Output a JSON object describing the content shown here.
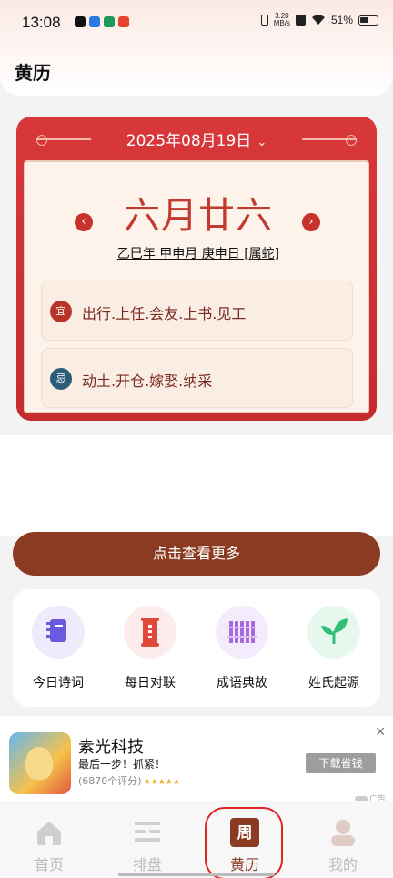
{
  "status_bar": {
    "time": "13:08",
    "net_speed_value": "3.20",
    "net_speed_unit": "MB/s",
    "battery": "51%"
  },
  "header": {
    "title": "黄历"
  },
  "calendar": {
    "date": "2025年08月19日",
    "lunar_date": "六月廿六",
    "ganzhi": "乙巳年 甲申月 庚申日 [属蛇]",
    "yi_badge": "宜",
    "yi_text": "出行.上任.会友.上书.见工",
    "ji_badge": "忌",
    "ji_text": "动土.开仓.嫁娶.纳采"
  },
  "more_button": "点击查看更多",
  "quick_links": [
    {
      "label": "今日诗词",
      "icon": "book-icon",
      "color": "#6a5ae0"
    },
    {
      "label": "每日对联",
      "icon": "scroll-icon",
      "color": "#e0483a"
    },
    {
      "label": "成语典故",
      "icon": "bamboo-slips-icon",
      "color": "#a86ae0"
    },
    {
      "label": "姓氏起源",
      "icon": "sprout-icon",
      "color": "#2ebf74"
    }
  ],
  "ad": {
    "name": "素光科技",
    "subtitle": "最后一步！抓紧！",
    "rating": "(6870个评分)",
    "stars": "★★★★★",
    "button": "下载省钱",
    "close": "✕",
    "tag": "广告"
  },
  "bottom_nav": [
    {
      "label": "首页",
      "icon": "home-icon",
      "active": false
    },
    {
      "label": "排盘",
      "icon": "chart-icon",
      "active": false
    },
    {
      "label": "黄历",
      "icon": "calendar-icon",
      "glyph": "周",
      "active": true
    },
    {
      "label": "我的",
      "icon": "profile-icon",
      "active": false
    }
  ],
  "colors": {
    "brand_red": "#c8322c",
    "brand_brown": "#8b3b22"
  }
}
